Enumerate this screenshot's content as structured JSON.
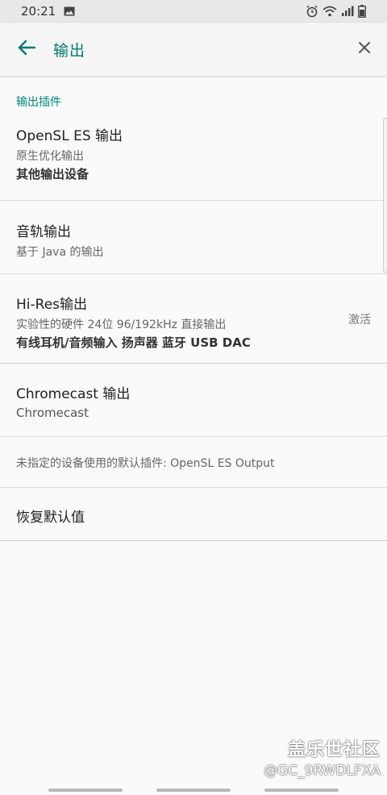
{
  "status_bar": {
    "time": "20:21",
    "icons": [
      "image-icon",
      "alarm-icon",
      "wifi-icon",
      "signal-icon",
      "battery-icon"
    ]
  },
  "app_bar": {
    "title": "输出",
    "back_icon": "arrow-left-icon",
    "close_icon": "close-icon"
  },
  "section": {
    "header": "输出插件"
  },
  "prefs": [
    {
      "title": "OpenSL ES 输出",
      "summary": "原生优化输出",
      "devices": "其他输出设备",
      "widget": ""
    },
    {
      "title": "音轨输出",
      "summary": "基于 Java 的输出",
      "devices": "",
      "widget": ""
    },
    {
      "title": "Hi-Res输出",
      "summary": "实验性的硬件 24位 96/192kHz 直接输出",
      "devices": "有线耳机/音频输入  扬声器  蓝牙  USB DAC",
      "widget": "激活"
    },
    {
      "title": "Chromecast 输出",
      "summary": "Chromecast",
      "devices": "",
      "widget": ""
    }
  ],
  "default_plugin_note": "未指定的设备使用的默认插件: OpenSL ES Output",
  "restore_defaults": "恢复默认值",
  "watermark": {
    "line1": "盖乐世社区",
    "line2": "@GC_9RWDLFXA"
  },
  "colors": {
    "accent": "#00796b",
    "section_header": "#00897b",
    "background": "#fafafa"
  }
}
